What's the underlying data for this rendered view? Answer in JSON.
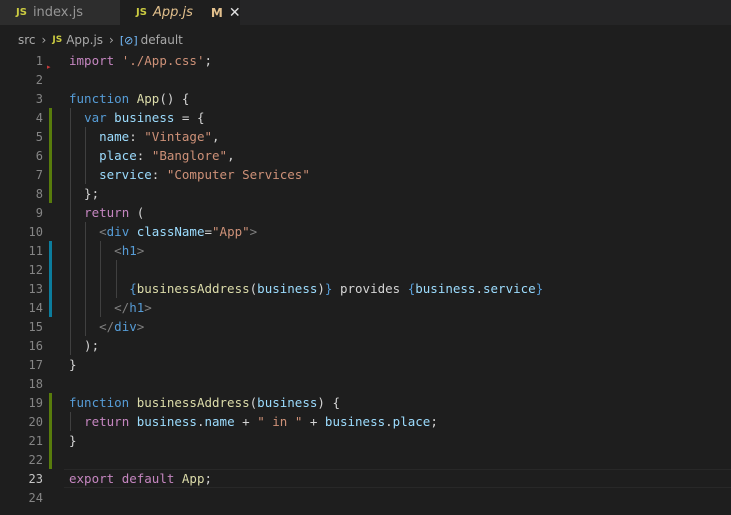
{
  "tabs": [
    {
      "badge": "JS",
      "name": "index.js",
      "active": false
    },
    {
      "badge": "JS",
      "name": "App.js",
      "active": true,
      "modified": "M",
      "close": "✕"
    }
  ],
  "breadcrumb": {
    "folder": "src",
    "file_badge": "JS",
    "file": "App.js",
    "symbol_icon": "[⊘]",
    "symbol": "default"
  },
  "colors": {
    "git_added": "#587c0c",
    "git_modified": "#0c7d9d",
    "keyword": "#569cd6",
    "control": "#c586c0",
    "string": "#ce9178",
    "function": "#dcdcaa",
    "variable": "#9cdcfe"
  },
  "current_line": 23,
  "lines": [
    {
      "n": 1,
      "t": [
        [
          "kc",
          "import"
        ],
        [
          "plain",
          " "
        ],
        [
          "str",
          "'./App.css'"
        ],
        [
          "plain",
          ";"
        ]
      ]
    },
    {
      "n": 2,
      "t": []
    },
    {
      "n": 3,
      "t": [
        [
          "kw",
          "function"
        ],
        [
          "plain",
          " "
        ],
        [
          "fn",
          "App"
        ],
        [
          "plain",
          "() {"
        ]
      ]
    },
    {
      "n": 4,
      "t": [
        [
          "plain",
          "  "
        ],
        [
          "kw",
          "var"
        ],
        [
          "plain",
          " "
        ],
        [
          "var",
          "business"
        ],
        [
          "plain",
          " = {"
        ]
      ],
      "git": "added"
    },
    {
      "n": 5,
      "t": [
        [
          "plain",
          "    "
        ],
        [
          "var",
          "name"
        ],
        [
          "plain",
          ": "
        ],
        [
          "str",
          "\"Vintage\""
        ],
        [
          "plain",
          ","
        ]
      ],
      "git": "added"
    },
    {
      "n": 6,
      "t": [
        [
          "plain",
          "    "
        ],
        [
          "var",
          "place"
        ],
        [
          "plain",
          ": "
        ],
        [
          "str",
          "\"Banglore\""
        ],
        [
          "plain",
          ","
        ]
      ],
      "git": "added"
    },
    {
      "n": 7,
      "t": [
        [
          "plain",
          "    "
        ],
        [
          "var",
          "service"
        ],
        [
          "plain",
          ": "
        ],
        [
          "str",
          "\"Computer Services\""
        ]
      ],
      "git": "added"
    },
    {
      "n": 8,
      "t": [
        [
          "plain",
          "  };"
        ]
      ],
      "git": "added"
    },
    {
      "n": 9,
      "t": [
        [
          "plain",
          "  "
        ],
        [
          "kc",
          "return"
        ],
        [
          "plain",
          " ("
        ]
      ]
    },
    {
      "n": 10,
      "t": [
        [
          "plain",
          "    "
        ],
        [
          "tag",
          "<"
        ],
        [
          "tagn",
          "div"
        ],
        [
          "plain",
          " "
        ],
        [
          "attr",
          "className"
        ],
        [
          "plain",
          "="
        ],
        [
          "str",
          "\"App\""
        ],
        [
          "tag",
          ">"
        ]
      ]
    },
    {
      "n": 11,
      "t": [
        [
          "plain",
          "      "
        ],
        [
          "tag",
          "<"
        ],
        [
          "tagn",
          "h1"
        ],
        [
          "tag",
          ">"
        ]
      ],
      "git": "modified"
    },
    {
      "n": 12,
      "t": [],
      "git": "modified"
    },
    {
      "n": 13,
      "t": [
        [
          "plain",
          "        "
        ],
        [
          "brace",
          "{"
        ],
        [
          "fn",
          "businessAddress"
        ],
        [
          "plain",
          "("
        ],
        [
          "var",
          "business"
        ],
        [
          "plain",
          ")"
        ],
        [
          "brace",
          "}"
        ],
        [
          "plain",
          " provides "
        ],
        [
          "brace",
          "{"
        ],
        [
          "var",
          "business"
        ],
        [
          "plain",
          "."
        ],
        [
          "var",
          "service"
        ],
        [
          "brace",
          "}"
        ]
      ],
      "git": "modified"
    },
    {
      "n": 14,
      "t": [
        [
          "plain",
          "      "
        ],
        [
          "tag",
          "</"
        ],
        [
          "tagn",
          "h1"
        ],
        [
          "tag",
          ">"
        ]
      ],
      "git": "modified"
    },
    {
      "n": 15,
      "t": [
        [
          "plain",
          "    "
        ],
        [
          "tag",
          "</"
        ],
        [
          "tagn",
          "div"
        ],
        [
          "tag",
          ">"
        ]
      ]
    },
    {
      "n": 16,
      "t": [
        [
          "plain",
          "  );"
        ]
      ]
    },
    {
      "n": 17,
      "t": [
        [
          "plain",
          "}"
        ]
      ]
    },
    {
      "n": 18,
      "t": []
    },
    {
      "n": 19,
      "t": [
        [
          "kw",
          "function"
        ],
        [
          "plain",
          " "
        ],
        [
          "fn",
          "businessAddress"
        ],
        [
          "plain",
          "("
        ],
        [
          "var",
          "business"
        ],
        [
          "plain",
          ") {"
        ]
      ],
      "git": "added"
    },
    {
      "n": 20,
      "t": [
        [
          "plain",
          "  "
        ],
        [
          "kc",
          "return"
        ],
        [
          "plain",
          " "
        ],
        [
          "var",
          "business"
        ],
        [
          "plain",
          "."
        ],
        [
          "var",
          "name"
        ],
        [
          "plain",
          " + "
        ],
        [
          "str",
          "\" in \""
        ],
        [
          "plain",
          " + "
        ],
        [
          "var",
          "business"
        ],
        [
          "plain",
          "."
        ],
        [
          "var",
          "place"
        ],
        [
          "plain",
          ";"
        ]
      ],
      "git": "added"
    },
    {
      "n": 21,
      "t": [
        [
          "plain",
          "}"
        ]
      ],
      "git": "added"
    },
    {
      "n": 22,
      "t": [],
      "git": "added"
    },
    {
      "n": 23,
      "t": [
        [
          "kc",
          "export"
        ],
        [
          "plain",
          " "
        ],
        [
          "kc",
          "default"
        ],
        [
          "plain",
          " "
        ],
        [
          "fn",
          "App"
        ],
        [
          "plain",
          ";"
        ]
      ]
    },
    {
      "n": 24,
      "t": []
    }
  ]
}
